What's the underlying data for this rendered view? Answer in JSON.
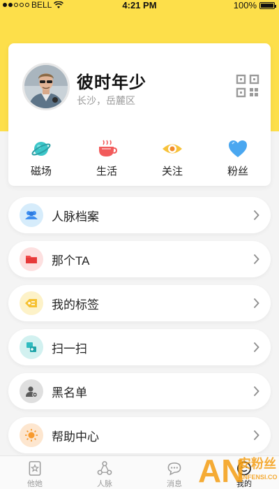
{
  "status_bar": {
    "carrier": "BELL",
    "time": "4:21 PM",
    "battery": "100%"
  },
  "profile": {
    "name": "彼时年少",
    "location": "长沙，岳麓区"
  },
  "stats": [
    {
      "label": "磁场",
      "icon": "planet-icon"
    },
    {
      "label": "生活",
      "icon": "coffee-cup-icon"
    },
    {
      "label": "关注",
      "icon": "eye-icon"
    },
    {
      "label": "粉丝",
      "icon": "heart-icon"
    }
  ],
  "menu": [
    {
      "label": "人脉档案",
      "icon": "contacts-icon",
      "color": "#d6ecfb"
    },
    {
      "label": "那个TA",
      "icon": "folder-icon",
      "color": "#fde0e0"
    },
    {
      "label": "我的标签",
      "icon": "tag-icon",
      "color": "#fdf2c8"
    },
    {
      "label": "扫一扫",
      "icon": "scan-icon",
      "color": "#d2f1f0"
    },
    {
      "label": "黑名单",
      "icon": "blacklist-icon",
      "color": "#dfdfdf"
    },
    {
      "label": "帮助中心",
      "icon": "sun-icon",
      "color": "#fde6cf"
    }
  ],
  "tabs": [
    {
      "label": "他她",
      "icon": "star-card-icon"
    },
    {
      "label": "人脉",
      "icon": "network-icon"
    },
    {
      "label": "消息",
      "icon": "chat-icon"
    },
    {
      "label": "我的",
      "icon": "smile-icon"
    }
  ],
  "watermark": {
    "big": "AN",
    "cn": "安粉丝",
    "url": "ANFENSI.COM"
  },
  "colors": {
    "brand_yellow": "#fddf4a",
    "background": "#f4f4f4"
  }
}
